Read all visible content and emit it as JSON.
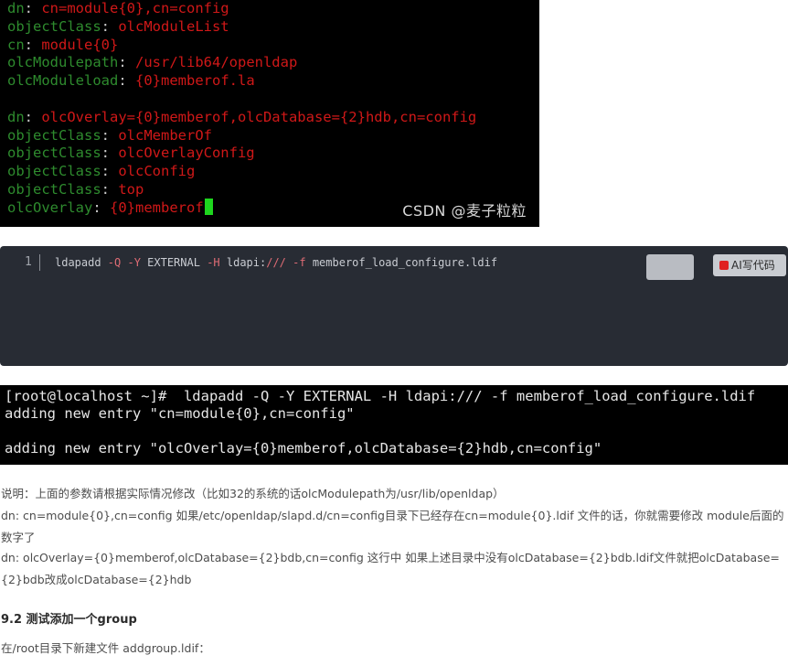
{
  "terminal_ldif": {
    "lines": [
      [
        {
          "t": "dn",
          "c": "k"
        },
        {
          "t": ": ",
          "c": "p"
        },
        {
          "t": "cn=module{0},cn=config",
          "c": "v"
        }
      ],
      [
        {
          "t": "objectClass",
          "c": "k"
        },
        {
          "t": ": ",
          "c": "p"
        },
        {
          "t": "olcModuleList",
          "c": "v"
        }
      ],
      [
        {
          "t": "cn",
          "c": "k"
        },
        {
          "t": ": ",
          "c": "p"
        },
        {
          "t": "module{0}",
          "c": "v"
        }
      ],
      [
        {
          "t": "olcModulepath",
          "c": "k"
        },
        {
          "t": ": ",
          "c": "p"
        },
        {
          "t": "/usr/lib64/openldap",
          "c": "v"
        }
      ],
      [
        {
          "t": "olcModuleload",
          "c": "k"
        },
        {
          "t": ": ",
          "c": "p"
        },
        {
          "t": "{0}memberof.la",
          "c": "v"
        }
      ],
      [],
      [
        {
          "t": "dn",
          "c": "k"
        },
        {
          "t": ": ",
          "c": "p"
        },
        {
          "t": "olcOverlay={0}memberof,olcDatabase={2}hdb,cn=config",
          "c": "v"
        }
      ],
      [
        {
          "t": "objectClass",
          "c": "k"
        },
        {
          "t": ": ",
          "c": "p"
        },
        {
          "t": "olcMemberOf",
          "c": "v"
        }
      ],
      [
        {
          "t": "objectClass",
          "c": "k"
        },
        {
          "t": ": ",
          "c": "p"
        },
        {
          "t": "olcOverlayConfig",
          "c": "v"
        }
      ],
      [
        {
          "t": "objectClass",
          "c": "k"
        },
        {
          "t": ": ",
          "c": "p"
        },
        {
          "t": "olcConfig",
          "c": "v"
        }
      ],
      [
        {
          "t": "objectClass",
          "c": "k"
        },
        {
          "t": ": ",
          "c": "p"
        },
        {
          "t": "top",
          "c": "v"
        }
      ],
      [
        {
          "t": "olcOverlay",
          "c": "k"
        },
        {
          "t": ": ",
          "c": "p"
        },
        {
          "t": "{0}memberof",
          "c": "v"
        }
      ]
    ],
    "watermark": "CSDN @麦子粒粒"
  },
  "code_block": {
    "line_number": "1",
    "tokens": [
      {
        "t": "ldapadd ",
        "c": ""
      },
      {
        "t": "-Q",
        "c": "opt"
      },
      {
        "t": " ",
        "c": ""
      },
      {
        "t": "-Y",
        "c": "opt"
      },
      {
        "t": " EXTERNAL ",
        "c": ""
      },
      {
        "t": "-H",
        "c": "opt"
      },
      {
        "t": " ldapi:",
        "c": ""
      },
      {
        "t": "///",
        "c": "opt"
      },
      {
        "t": " ",
        "c": ""
      },
      {
        "t": "-f",
        "c": "opt"
      },
      {
        "t": " memberof_load_configure.ldif",
        "c": ""
      }
    ],
    "ai_button_label": "AI写代码"
  },
  "terminal_output": {
    "lines": [
      "[root@localhost ~]#  ldapadd -Q -Y EXTERNAL -H ldapi:/// -f memberof_load_configure.ldif",
      "adding new entry \"cn=module{0},cn=config\"",
      "",
      "adding new entry \"olcOverlay={0}memberof,olcDatabase={2}hdb,cn=config\""
    ]
  },
  "article": {
    "note": "说明：上面的参数请根据实际情况修改（比如32的系统的话olcModulepath为/usr/lib/openldap）",
    "dn1": "dn: cn=module{0},cn=config 如果/etc/openldap/slapd.d/cn=config目录下已经存在cn=module{0}.ldif 文件的话，你就需要修改 module后面的数字了",
    "dn2": "dn: olcOverlay={0}memberof,olcDatabase={2}bdb,cn=config 这行中 如果上述目录中没有olcDatabase={2}bdb.ldif文件就把olcDatabase={2}bdb改成olcDatabase={2}hdb",
    "heading": "9.2 测试添加一个group",
    "instruction": "在/root目录下新建文件 addgroup.ldif："
  }
}
